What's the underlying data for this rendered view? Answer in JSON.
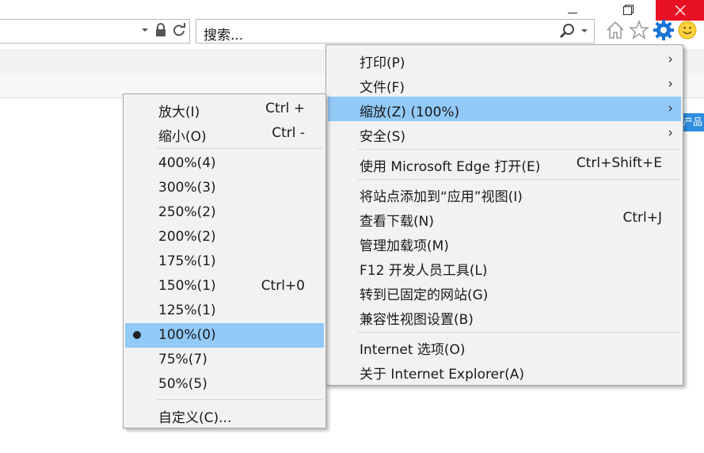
{
  "search": {
    "placeholder": "搜索..."
  },
  "colors": {
    "selected": "#91c9f7",
    "menu_bg": "#f2f2f2",
    "close": "#e81123",
    "gear": "#1a74d8"
  },
  "edge_tag": "产品",
  "main_menu": {
    "print": {
      "label": "打印(P)",
      "arrow": "›"
    },
    "file": {
      "label": "文件(F)",
      "arrow": "›"
    },
    "zoom": {
      "label": "缩放(Z) (100%)",
      "arrow": "›"
    },
    "security": {
      "label": "安全(S)",
      "arrow": "›"
    },
    "edge": {
      "label": "使用 Microsoft Edge 打开(E)",
      "shortcut": "Ctrl+Shift+E"
    },
    "add_app": {
      "label": "将站点添加到“应用”视图(I)"
    },
    "downloads": {
      "label": "查看下载(N)",
      "shortcut": "Ctrl+J"
    },
    "addons": {
      "label": "管理加载项(M)"
    },
    "f12": {
      "label": "F12 开发人员工具(L)"
    },
    "pinned": {
      "label": "转到已固定的网站(G)"
    },
    "compat": {
      "label": "兼容性视图设置(B)"
    },
    "options": {
      "label": "Internet 选项(O)"
    },
    "about": {
      "label": "关于 Internet Explorer(A)"
    }
  },
  "zoom_menu": {
    "zoom_in": {
      "label": "放大(I)",
      "shortcut": "Ctrl +"
    },
    "zoom_out": {
      "label": "缩小(O)",
      "shortcut": "Ctrl -"
    },
    "levels": [
      {
        "label": "400%(4)",
        "shortcut": ""
      },
      {
        "label": "300%(3)",
        "shortcut": ""
      },
      {
        "label": "250%(2)",
        "shortcut": ""
      },
      {
        "label": "200%(2)",
        "shortcut": ""
      },
      {
        "label": "175%(1)",
        "shortcut": ""
      },
      {
        "label": "150%(1)",
        "shortcut": "Ctrl+0"
      },
      {
        "label": "125%(1)",
        "shortcut": ""
      },
      {
        "label": "100%(0)",
        "shortcut": ""
      },
      {
        "label": "75%(7)",
        "shortcut": ""
      },
      {
        "label": "50%(5)",
        "shortcut": ""
      }
    ],
    "custom": {
      "label": "自定义(C)..."
    }
  }
}
